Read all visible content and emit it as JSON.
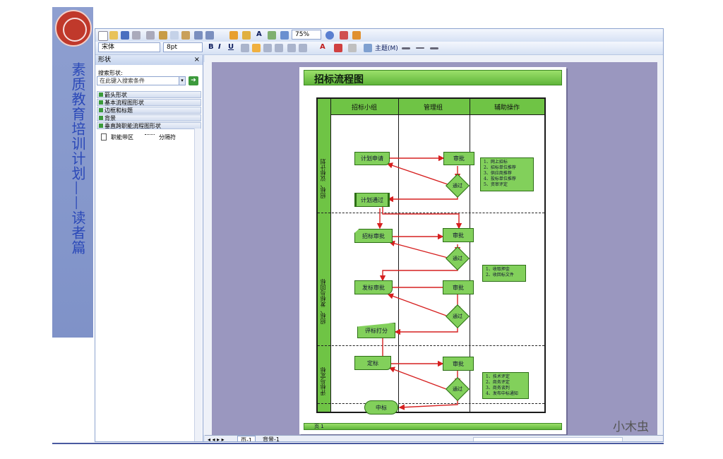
{
  "slide": {
    "side_title": "素质教育培训计划——读者篇",
    "watermark": "小木虫"
  },
  "toolbar": {
    "zoom": "75%",
    "font_name": "宋体",
    "font_size": "8pt",
    "theme_label": "主题(M)"
  },
  "shapes_panel": {
    "title": "形状",
    "search_label": "搜索形状:",
    "search_placeholder": "在此键入搜索条件",
    "stencils": [
      "箭头形状",
      "基本流程图形状",
      "边框和标题",
      "背景",
      "垂直跨职能流程图形状"
    ],
    "items": [
      "职能带区",
      "分隔符"
    ]
  },
  "status": {
    "page_tab": "页-1",
    "bg_tab": "背景-1"
  },
  "diagram": {
    "title": "招标流程图",
    "columns": [
      "招标小组",
      "管理组",
      "辅助操作"
    ],
    "phases": [
      "招标、议标计划",
      "招标、发标与回标",
      "评标与定标"
    ],
    "nodes": {
      "plan_apply": "计划申请",
      "approve1": "审批",
      "pass1": "通过",
      "plan_pass": "计划通过",
      "tender_review": "招标审批",
      "approve2": "审批",
      "pass2": "通过",
      "issue_review": "发标审批",
      "approve3": "审批",
      "pass3": "通过",
      "score": "评标打分",
      "decide": "定标",
      "approve4": "审批",
      "pass4": "通过",
      "win": "中标"
    },
    "notes": {
      "note1": [
        "1、网上招标",
        "2、招标单位推荐",
        "3、供应商推荐",
        "4、投标单位推荐",
        "5、资审评定"
      ],
      "note2": [
        "1、收取押金",
        "2、收回标文件"
      ],
      "note3": [
        "1、技术评定",
        "2、商务评定",
        "3、商务谈判",
        "4、发布中标通知"
      ]
    },
    "footer": "页 1"
  }
}
